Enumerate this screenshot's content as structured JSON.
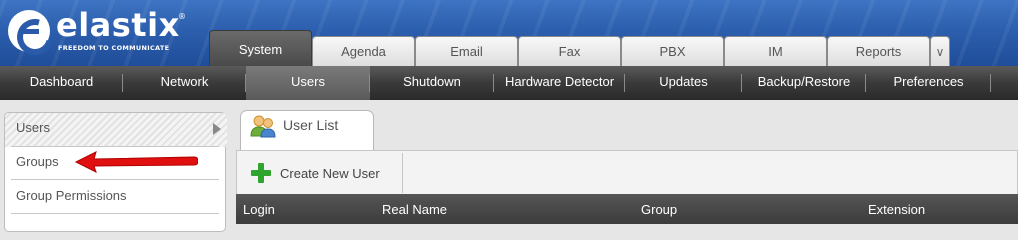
{
  "brand": {
    "name": "elastix",
    "reg_mark": "®",
    "tagline": "FREEDOM TO COMMUNICATE"
  },
  "top_tabs": [
    {
      "label": "System",
      "active": true
    },
    {
      "label": "Agenda",
      "active": false
    },
    {
      "label": "Email",
      "active": false
    },
    {
      "label": "Fax",
      "active": false
    },
    {
      "label": "PBX",
      "active": false
    },
    {
      "label": "IM",
      "active": false
    },
    {
      "label": "Reports",
      "active": false
    }
  ],
  "top_tabs_more_icon": "chevron-down-icon",
  "submenu": [
    {
      "label": "Dashboard",
      "active": false
    },
    {
      "label": "Network",
      "active": false
    },
    {
      "label": "Users",
      "active": true
    },
    {
      "label": "Shutdown",
      "active": false
    },
    {
      "label": "Hardware Detector",
      "active": false
    },
    {
      "label": "Updates",
      "active": false
    },
    {
      "label": "Backup/Restore",
      "active": false
    },
    {
      "label": "Preferences",
      "active": false
    }
  ],
  "sidebar": {
    "items": [
      {
        "label": "Users",
        "active": true
      },
      {
        "label": "Groups",
        "active": false
      },
      {
        "label": "Group Permissions",
        "active": false
      }
    ]
  },
  "panel": {
    "tab_label": "User List",
    "create_button_label": "Create New User",
    "columns": [
      "Login",
      "Real Name",
      "Group",
      "Extension"
    ]
  },
  "colors": {
    "header_blue": "#2c5fae",
    "submenu_dark": "#3a3a3a",
    "annotation_red": "#e01010",
    "plus_green": "#2fa52f"
  }
}
